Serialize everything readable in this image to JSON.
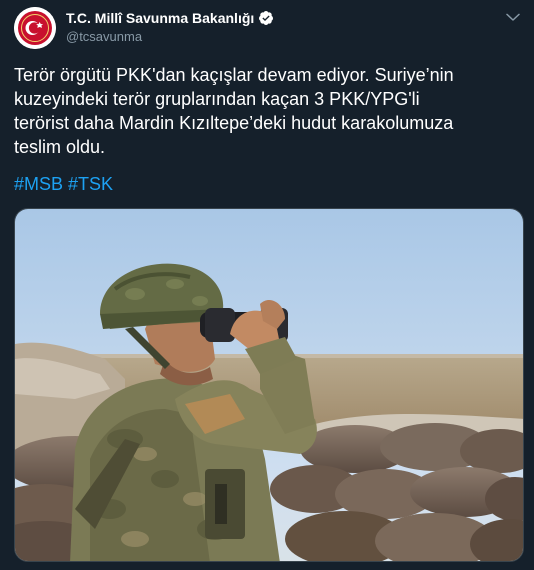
{
  "account": {
    "display_name": "T.C. Millî Savunma Bakanlığı",
    "handle": "@tcsavunma",
    "verified": true,
    "avatar_icon": "ministry-emblem-icon"
  },
  "tweet": {
    "text_lines": [
      "Terör örgütü PKK'dan kaçışlar devam ediyor. Suriye’nin",
      "kuzeyindeki terör gruplarından kaçan 3 PKK/YPG'li",
      "terörist daha Mardin Kızıltepe’deki hudut karakolumuza",
      "teslim oldu."
    ],
    "hashtags": [
      "#MSB",
      "#TSK"
    ]
  },
  "colors": {
    "background": "#15202b",
    "text": "#ffffff",
    "secondary_text": "#8899a6",
    "link": "#1da1f2",
    "verified_badge": "#ffffff"
  },
  "menu": {
    "caret_icon": "chevron-down-icon"
  },
  "media": {
    "type": "photo",
    "icon": "soldier-binoculars-photo"
  }
}
